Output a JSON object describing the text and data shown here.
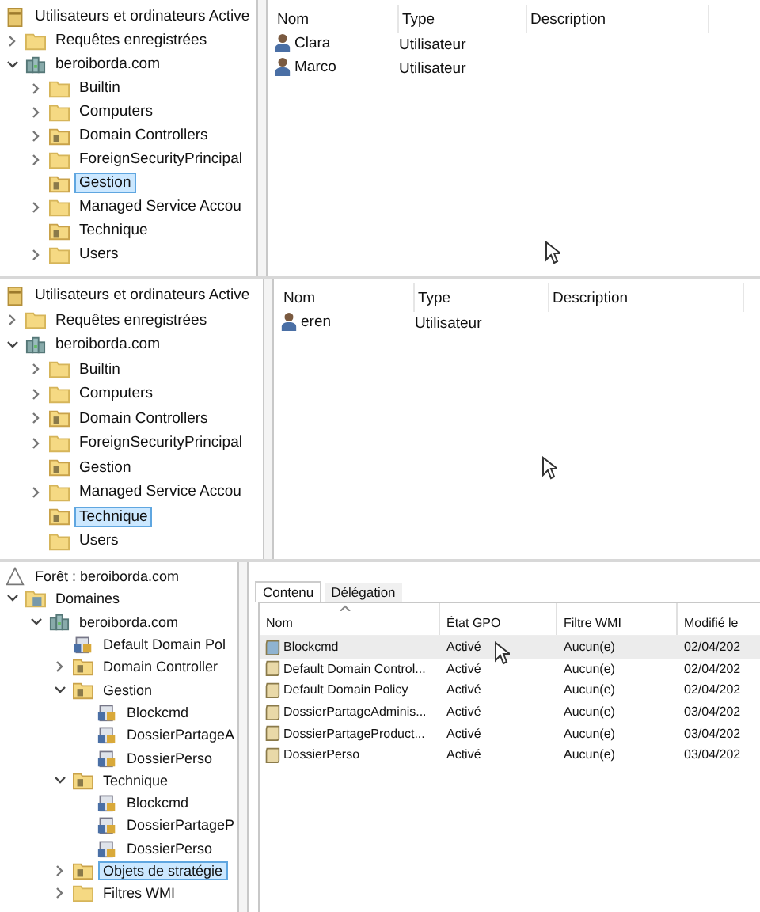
{
  "panels": [
    {
      "kind": "users",
      "tree": {
        "label": "Utilisateurs et ordinateurs Active",
        "kind": "ad-root",
        "selected": false,
        "children": [
          {
            "label": "Requêtes enregistrées",
            "kind": "folder",
            "expanded": false,
            "selected": false
          },
          {
            "label": "beroiborda.com",
            "kind": "domain",
            "expanded": true,
            "selected": false,
            "children": [
              {
                "label": "Builtin",
                "kind": "folder",
                "expanded": false,
                "selected": false
              },
              {
                "label": "Computers",
                "kind": "folder",
                "expanded": false,
                "selected": false
              },
              {
                "label": "Domain Controllers",
                "kind": "ou",
                "expanded": false,
                "selected": false
              },
              {
                "label": "ForeignSecurityPrincipal",
                "kind": "folder",
                "expanded": false,
                "selected": false
              },
              {
                "label": "Gestion",
                "kind": "ou",
                "selected": true
              },
              {
                "label": "Managed Service Accou",
                "kind": "folder",
                "expanded": false,
                "selected": false
              },
              {
                "label": "Technique",
                "kind": "ou",
                "selected": false
              },
              {
                "label": "Users",
                "kind": "folder",
                "expanded": false,
                "selected": false
              }
            ]
          }
        ]
      },
      "list": {
        "columns": [
          "Nom",
          "Type",
          "Description"
        ],
        "rows": [
          {
            "name": "Clara",
            "type": "Utilisateur"
          },
          {
            "name": "Marco",
            "type": "Utilisateur"
          }
        ]
      }
    },
    {
      "kind": "users",
      "tree": {
        "label": "Utilisateurs et ordinateurs Active",
        "kind": "ad-root",
        "selected": false,
        "children": [
          {
            "label": "Requêtes enregistrées",
            "kind": "folder",
            "expanded": false,
            "selected": false
          },
          {
            "label": "beroiborda.com",
            "kind": "domain",
            "expanded": true,
            "selected": false,
            "children": [
              {
                "label": "Builtin",
                "kind": "folder",
                "expanded": false,
                "selected": false
              },
              {
                "label": "Computers",
                "kind": "folder",
                "expanded": false,
                "selected": false
              },
              {
                "label": "Domain Controllers",
                "kind": "ou",
                "expanded": false,
                "selected": false
              },
              {
                "label": "ForeignSecurityPrincipal",
                "kind": "folder",
                "expanded": false,
                "selected": false
              },
              {
                "label": "Gestion",
                "kind": "ou",
                "selected": false
              },
              {
                "label": "Managed Service Accou",
                "kind": "folder",
                "expanded": false,
                "selected": false
              },
              {
                "label": "Technique",
                "kind": "ou",
                "selected": true
              },
              {
                "label": "Users",
                "kind": "folder",
                "selected": false
              }
            ]
          }
        ]
      },
      "list": {
        "columns": [
          "Nom",
          "Type",
          "Description"
        ],
        "rows": [
          {
            "name": "eren",
            "type": "Utilisateur"
          }
        ]
      }
    },
    {
      "kind": "gpo",
      "tree": {
        "label": "Forêt : beroiborda.com",
        "kind": "forest",
        "selected": false,
        "children": [
          {
            "label": "Domaines",
            "kind": "domains",
            "expanded": true,
            "selected": false,
            "children": [
              {
                "label": "beroiborda.com",
                "kind": "domain",
                "expanded": true,
                "selected": false,
                "children": [
                  {
                    "label": "Default Domain Pol",
                    "kind": "gpo-link",
                    "selected": false
                  },
                  {
                    "label": "Domain Controller",
                    "kind": "ou",
                    "expanded": false,
                    "selected": false
                  },
                  {
                    "label": "Gestion",
                    "kind": "ou",
                    "expanded": true,
                    "selected": false,
                    "children": [
                      {
                        "label": "Blockcmd",
                        "kind": "gpo-link",
                        "selected": false
                      },
                      {
                        "label": "DossierPartageA",
                        "kind": "gpo-link",
                        "selected": false
                      },
                      {
                        "label": "DossierPerso",
                        "kind": "gpo-link",
                        "selected": false
                      }
                    ]
                  },
                  {
                    "label": "Technique",
                    "kind": "ou",
                    "expanded": true,
                    "selected": false,
                    "children": [
                      {
                        "label": "Blockcmd",
                        "kind": "gpo-link",
                        "selected": false
                      },
                      {
                        "label": "DossierPartageP",
                        "kind": "gpo-link",
                        "selected": false
                      },
                      {
                        "label": "DossierPerso",
                        "kind": "gpo-link",
                        "selected": false
                      }
                    ]
                  },
                  {
                    "label": "Objets de stratégie",
                    "kind": "ou",
                    "expanded": false,
                    "selected": true
                  },
                  {
                    "label": "Filtres WMI",
                    "kind": "folder",
                    "expanded": false,
                    "selected": false
                  }
                ]
              }
            ]
          }
        ]
      },
      "tabs": [
        {
          "label": "Contenu",
          "selected": true
        },
        {
          "label": "Délégation",
          "selected": false
        }
      ],
      "list": {
        "columns": [
          "Nom",
          "État GPO",
          "Filtre WMI",
          "Modifié le"
        ],
        "rows": [
          {
            "name": "Blockcmd",
            "state": "Activé",
            "filter": "Aucun(e)",
            "date": "02/04/202",
            "selected": true
          },
          {
            "name": "Default Domain Control...",
            "state": "Activé",
            "filter": "Aucun(e)",
            "date": "02/04/202",
            "selected": false
          },
          {
            "name": "Default Domain Policy",
            "state": "Activé",
            "filter": "Aucun(e)",
            "date": "02/04/202",
            "selected": false
          },
          {
            "name": "DossierPartageAdminis...",
            "state": "Activé",
            "filter": "Aucun(e)",
            "date": "03/04/202",
            "selected": false
          },
          {
            "name": "DossierPartageProduct...",
            "state": "Activé",
            "filter": "Aucun(e)",
            "date": "03/04/202",
            "selected": false
          },
          {
            "name": "DossierPerso",
            "state": "Activé",
            "filter": "Aucun(e)",
            "date": "03/04/202",
            "selected": false
          }
        ]
      }
    }
  ]
}
